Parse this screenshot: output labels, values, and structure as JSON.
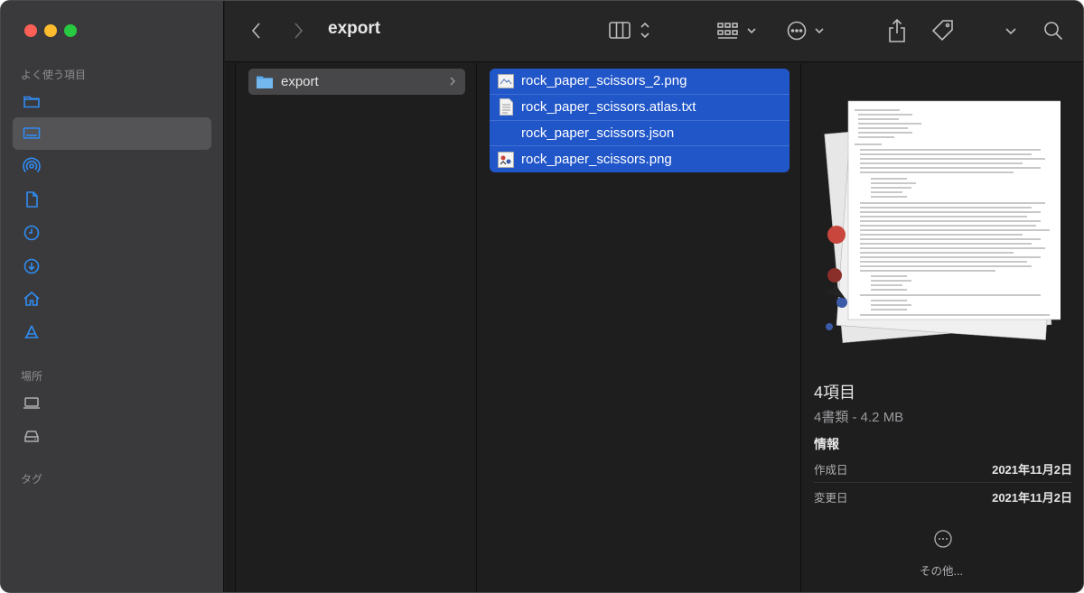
{
  "window": {
    "title": "export",
    "accent": "#2156c9"
  },
  "sidebar": {
    "favorites_heading": "よく使う項目",
    "locations_heading": "場所",
    "tags_heading": "タグ",
    "favorites": [
      {
        "icon": "folder-icon"
      },
      {
        "icon": "desktop-icon",
        "selected": true
      },
      {
        "icon": "airdrop-icon"
      },
      {
        "icon": "document-icon"
      },
      {
        "icon": "clock-icon"
      },
      {
        "icon": "download-icon"
      },
      {
        "icon": "home-icon"
      },
      {
        "icon": "applications-icon"
      }
    ],
    "locations": [
      {
        "icon": "laptop-icon"
      },
      {
        "icon": "drive-icon"
      }
    ]
  },
  "columns": {
    "folder": {
      "name": "export"
    },
    "files": [
      {
        "name": "rock_paper_scissors_2.png",
        "icon": "image-file-icon"
      },
      {
        "name": "rock_paper_scissors.atlas.txt",
        "icon": "text-file-icon"
      },
      {
        "name": "rock_paper_scissors.json",
        "icon": "none"
      },
      {
        "name": "rock_paper_scissors.png",
        "icon": "image-file-icon"
      }
    ]
  },
  "preview": {
    "count": "4項目",
    "size": "4書類 - 4.2 MB",
    "info_heading": "情報",
    "rows": [
      {
        "label": "作成日",
        "value": "2021年11月2日"
      },
      {
        "label": "変更日",
        "value": "2021年11月2日"
      }
    ],
    "more_label": "その他..."
  }
}
